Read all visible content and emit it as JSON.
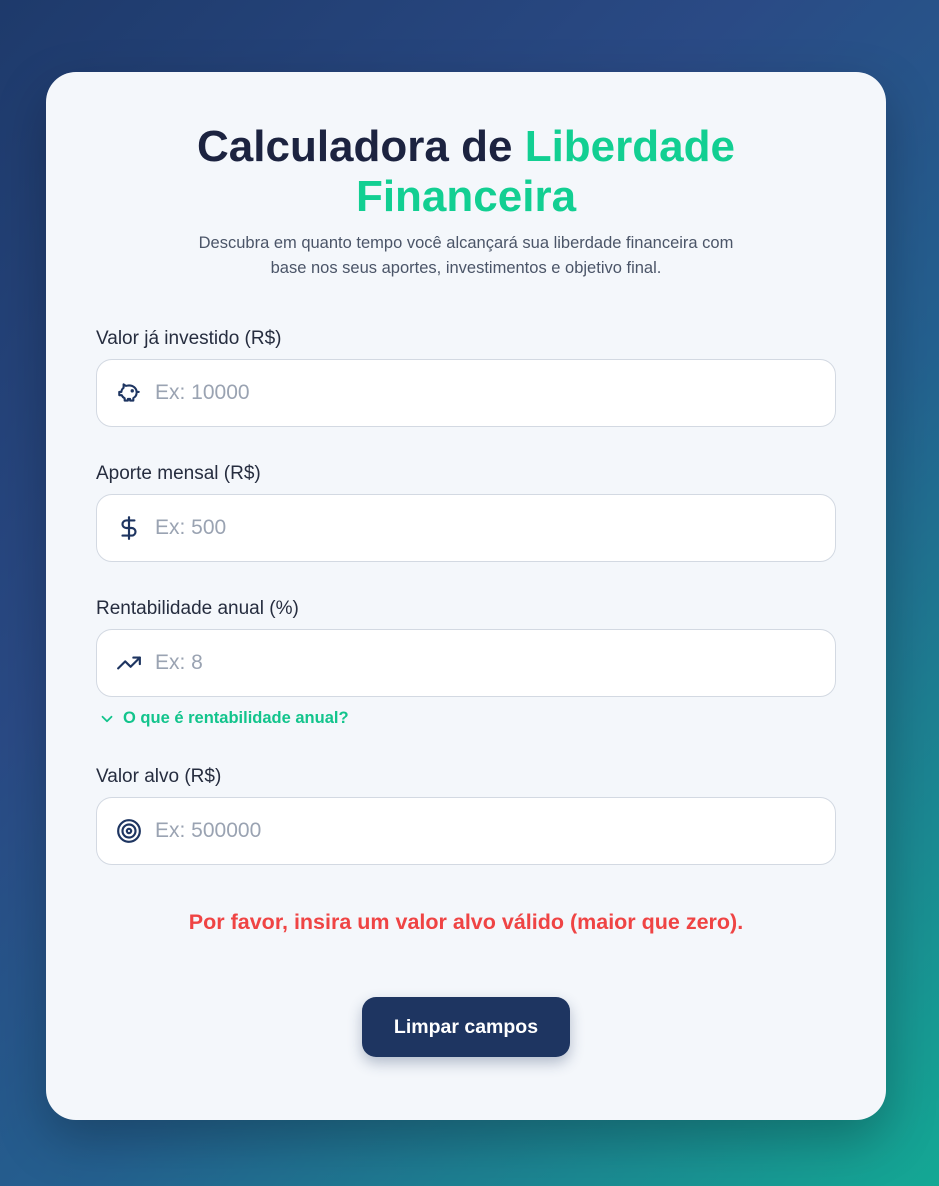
{
  "header": {
    "title_part1": "Calculadora de ",
    "title_accent": "Liberdade Financeira",
    "subtitle": "Descubra em quanto tempo você alcançará sua liberdade financeira com base nos seus aportes, investimentos e objetivo final."
  },
  "fields": {
    "invested": {
      "label": "Valor já investido (R$)",
      "placeholder": "Ex: 10000",
      "value": "",
      "icon": "piggy-bank-icon"
    },
    "monthly": {
      "label": "Aporte mensal (R$)",
      "placeholder": "Ex: 500",
      "value": "",
      "icon": "dollar-sign-icon"
    },
    "rate": {
      "label": "Rentabilidade anual (%)",
      "placeholder": "Ex: 8",
      "value": "",
      "icon": "trending-up-icon"
    },
    "target": {
      "label": "Valor alvo (R$)",
      "placeholder": "Ex: 500000",
      "value": "",
      "icon": "target-icon"
    }
  },
  "help": {
    "rate_link": "O que é rentabilidade anual?"
  },
  "error_message": "Por favor, insira um valor alvo válido (maior que zero).",
  "actions": {
    "clear_label": "Limpar campos"
  },
  "colors": {
    "accent": "#12cf92",
    "primary": "#1e3561",
    "error": "#ef4444"
  }
}
